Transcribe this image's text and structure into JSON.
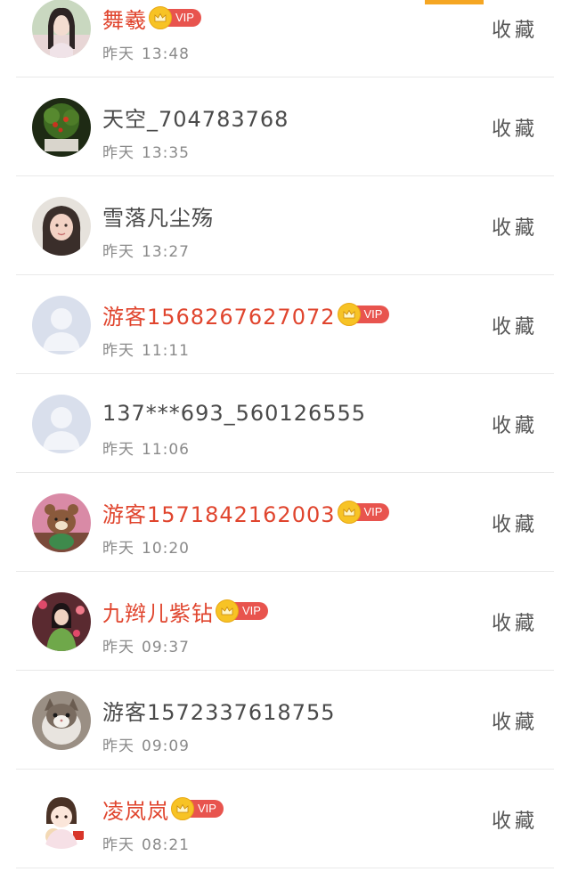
{
  "accent": "#f5a623",
  "vip_color": "#e0452e",
  "rows": [
    {
      "name": "舞羲",
      "vip": true,
      "vip_label": "VIP",
      "day": "昨天",
      "time": "13:48",
      "fav_label": "收藏",
      "avatar": "girl-portrait"
    },
    {
      "name": "天空_704783768",
      "vip": false,
      "day": "昨天",
      "time": "13:35",
      "fav_label": "收藏",
      "avatar": "plant-photo"
    },
    {
      "name": "雪落凡尘殇",
      "vip": false,
      "day": "昨天",
      "time": "13:27",
      "fav_label": "收藏",
      "avatar": "girl-selfie"
    },
    {
      "name": "游客1568267627072",
      "vip": true,
      "vip_label": "VIP",
      "day": "昨天",
      "time": "11:11",
      "fav_label": "收藏",
      "avatar": "default-avatar"
    },
    {
      "name": "137***693_560126555",
      "vip": false,
      "day": "昨天",
      "time": "11:06",
      "fav_label": "收藏",
      "avatar": "default-avatar"
    },
    {
      "name": "游客1571842162003",
      "vip": true,
      "vip_label": "VIP",
      "day": "昨天",
      "time": "10:20",
      "fav_label": "收藏",
      "avatar": "bear-toy"
    },
    {
      "name": "九辫儿紫钻",
      "vip": true,
      "vip_label": "VIP",
      "day": "昨天",
      "time": "09:37",
      "fav_label": "收藏",
      "avatar": "person-green"
    },
    {
      "name": "游客1572337618755",
      "vip": false,
      "day": "昨天",
      "time": "09:09",
      "fav_label": "收藏",
      "avatar": "cat-photo"
    },
    {
      "name": "凌岚岚",
      "vip": true,
      "vip_label": "VIP",
      "day": "昨天",
      "time": "08:21",
      "fav_label": "收藏",
      "avatar": "cartoon-girl"
    }
  ]
}
